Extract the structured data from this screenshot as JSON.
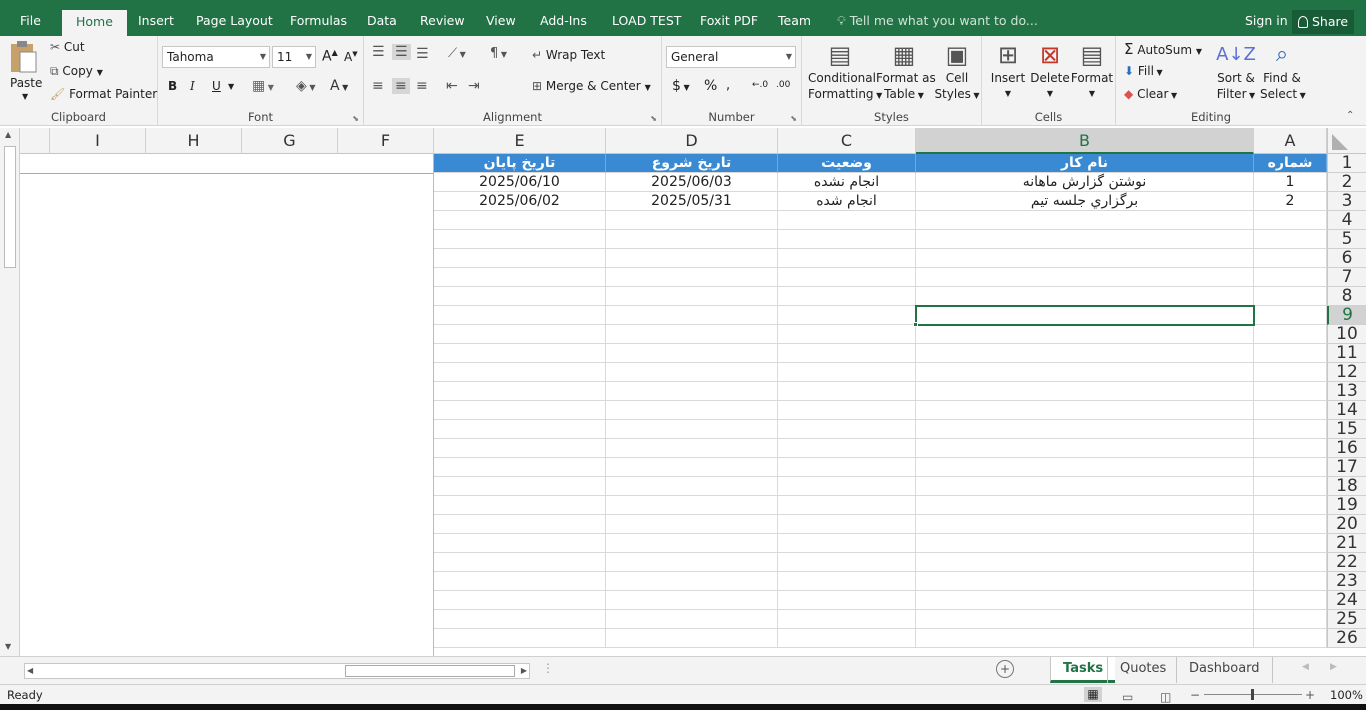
{
  "tabs": [
    "File",
    "Home",
    "Insert",
    "Page Layout",
    "Formulas",
    "Data",
    "Review",
    "View",
    "Add-Ins",
    "LOAD TEST",
    "Foxit PDF",
    "Team"
  ],
  "tell_me": "Tell me what you want to do...",
  "sign_in": "Sign in",
  "share": "Share",
  "clipboard": {
    "paste": "Paste",
    "cut": "Cut",
    "copy": "Copy",
    "format_painter": "Format Painter",
    "label": "Clipboard"
  },
  "font": {
    "name": "Tahoma",
    "size": "11",
    "bold": "B",
    "italic": "I",
    "underline": "U",
    "label": "Font"
  },
  "alignment": {
    "wrap": "Wrap Text",
    "merge": "Merge & Center",
    "label": "Alignment"
  },
  "number": {
    "format": "General",
    "label": "Number"
  },
  "styles": {
    "cond1": "Conditional",
    "cond2": "Formatting",
    "fmt1": "Format as",
    "fmt2": "Table",
    "cell1": "Cell",
    "cell2": "Styles",
    "label": "Styles"
  },
  "cells": {
    "insert": "Insert",
    "delete": "Delete",
    "format": "Format",
    "label": "Cells"
  },
  "editing": {
    "autosum": "AutoSum",
    "fill": "Fill",
    "clear": "Clear",
    "sort1": "Sort &",
    "sort2": "Filter",
    "find1": "Find &",
    "find2": "Select",
    "label": "Editing"
  },
  "columns": [
    "A",
    "B",
    "C",
    "D",
    "E",
    "F",
    "G",
    "H",
    "I"
  ],
  "rows": [
    "1",
    "2",
    "3",
    "4",
    "5",
    "6",
    "7",
    "8",
    "9",
    "10",
    "11",
    "12",
    "13",
    "14",
    "15",
    "16",
    "17",
    "18",
    "19",
    "20",
    "21",
    "22",
    "23",
    "24",
    "25",
    "26"
  ],
  "headers": [
    "شماره",
    "نام کار",
    "وضعیت",
    "تاریخ شروع",
    "تاریخ پایان"
  ],
  "data": [
    [
      "1",
      "نوشتن گزارش ماهانه",
      "انجام نشده",
      "2025/06/03",
      "2025/06/10"
    ],
    [
      "2",
      "برگزاري جلسه تيم",
      "انجام شده",
      "2025/05/31",
      "2025/06/02"
    ]
  ],
  "sheets": [
    "Tasks",
    "Quotes",
    "Dashboard"
  ],
  "status": "Ready",
  "zoom": "100%"
}
